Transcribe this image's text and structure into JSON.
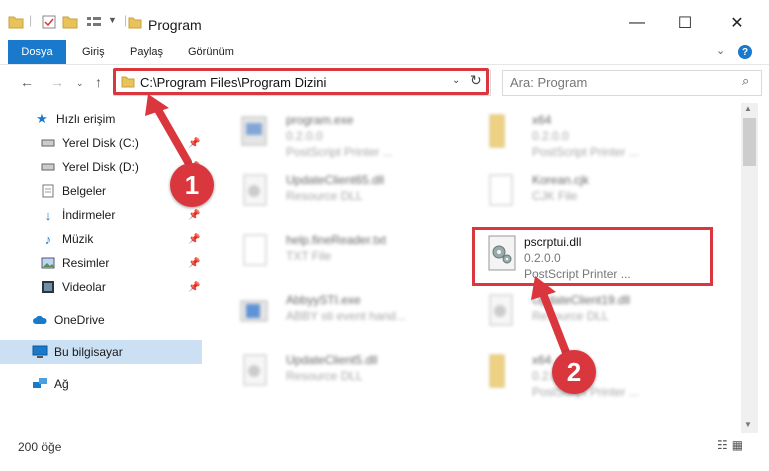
{
  "window": {
    "title": "Program",
    "controls": {
      "minimize": "—",
      "maximize": "☐",
      "close": "✕"
    }
  },
  "ribbon": {
    "tabs": [
      "Dosya",
      "Giriş",
      "Paylaş",
      "Görünüm"
    ],
    "help": "?"
  },
  "address": {
    "path": "C:\\Program Files\\Program Dizini",
    "search_placeholder": "Ara: Program"
  },
  "nav": {
    "quick_access": "Hızlı erişim",
    "items": [
      {
        "label": "Yerel Disk (C:)",
        "icon": "drive-icon",
        "pinned": true
      },
      {
        "label": "Yerel Disk (D:)",
        "icon": "drive-icon",
        "pinned": true
      },
      {
        "label": "Belgeler",
        "icon": "documents-icon",
        "pinned": true
      },
      {
        "label": "İndirmeler",
        "icon": "download-icon",
        "pinned": true
      },
      {
        "label": "Müzik",
        "icon": "music-icon",
        "pinned": true
      },
      {
        "label": "Resimler",
        "icon": "pictures-icon",
        "pinned": true
      },
      {
        "label": "Videolar",
        "icon": "videos-icon",
        "pinned": true
      }
    ],
    "onedrive": "OneDrive",
    "this_pc": "Bu bilgisayar",
    "network": "Ağ"
  },
  "files": [
    {
      "name": "program.exe",
      "sub1": "0.2.0.0",
      "sub2": "PostScript Printer ...",
      "type": "exe-icon"
    },
    {
      "name": "x64",
      "sub1": "0.2.0.0",
      "sub2": "PostScript Printer ...",
      "type": "folder-icon"
    },
    {
      "name": "UpdateClient65.dll",
      "sub1": "Resource DLL",
      "sub2": "",
      "type": "dll-icon"
    },
    {
      "name": "Korean.cjk",
      "sub1": "CJK File",
      "sub2": "",
      "type": "file-icon"
    },
    {
      "name": "help.fineReader.txt",
      "sub1": "TXT File",
      "sub2": "",
      "type": "file-icon"
    },
    {
      "name": "pscrptui.dll",
      "sub1": "0.2.0.0",
      "sub2": "PostScript Printer ...",
      "type": "dll-icon"
    },
    {
      "name": "AbbyySTI.exe",
      "sub1": "ABBY sti event hand...",
      "sub2": "",
      "type": "exe-icon"
    },
    {
      "name": "UpdateClient19.dll",
      "sub1": "Resource DLL",
      "sub2": "",
      "type": "dll-icon"
    },
    {
      "name": "UpdateClient5.dll",
      "sub1": "Resource DLL",
      "sub2": "",
      "type": "dll-icon"
    },
    {
      "name": "x64",
      "sub1": "0.2.0.0",
      "sub2": "PostScript Printer ...",
      "type": "folder-icon"
    }
  ],
  "status": {
    "count": "200 öğe"
  },
  "annotations": {
    "step1": "1",
    "step2": "2"
  },
  "colors": {
    "accent": "#1979ca",
    "annotation": "#d9363e",
    "selection": "#cce0f4"
  }
}
